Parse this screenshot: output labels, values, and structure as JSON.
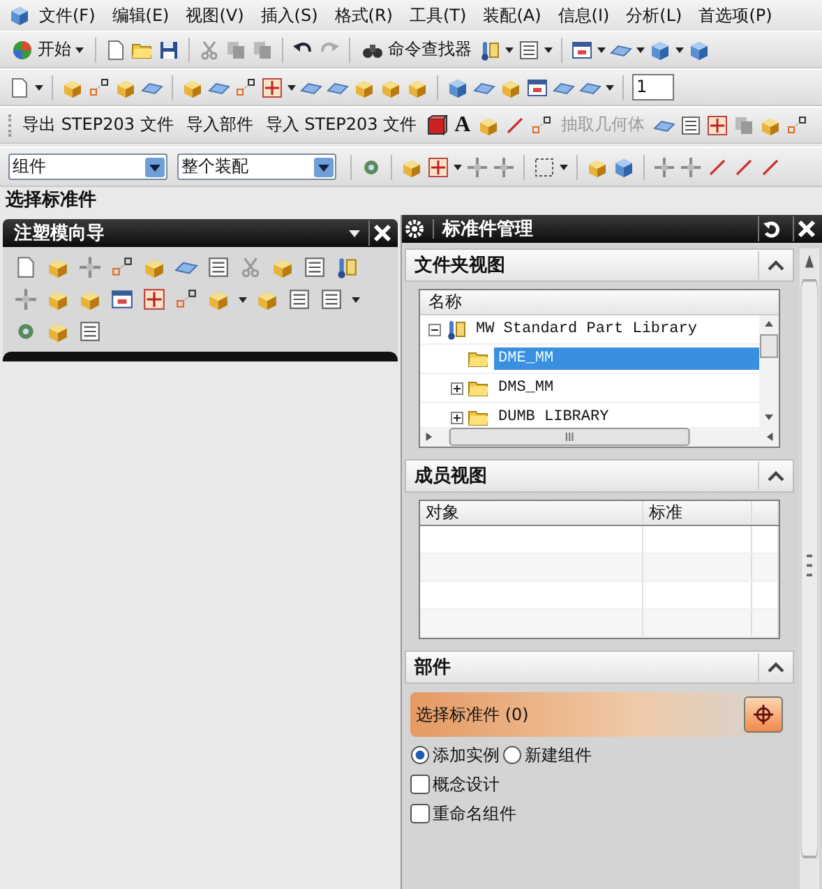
{
  "menu": [
    {
      "label": "文件(F)"
    },
    {
      "label": "编辑(E)"
    },
    {
      "label": "视图(V)"
    },
    {
      "label": "插入(S)"
    },
    {
      "label": "格式(R)"
    },
    {
      "label": "工具(T)"
    },
    {
      "label": "装配(A)"
    },
    {
      "label": "信息(I)"
    },
    {
      "label": "分析(L)"
    },
    {
      "label": "首选项(P)"
    }
  ],
  "toolbar_1": {
    "start_button": "开始",
    "command_finder": "命令查找器"
  },
  "toolbar_2": {
    "layer": "1"
  },
  "toolbar_3": {
    "commands": [
      {
        "label": "导出 STEP203 文件",
        "disabled": false
      },
      {
        "label": "导入部件",
        "disabled": false
      },
      {
        "label": "导入 STEP203 文件",
        "disabled": false
      }
    ],
    "text_tool": "A",
    "extract": {
      "label": "抽取几何体",
      "disabled": true
    }
  },
  "toolbar_4": {
    "filters": [
      {
        "value": "组件"
      },
      {
        "value": "整个装配"
      }
    ]
  },
  "cue_line": "选择标准件",
  "left_panel": {
    "title": "注塑模向导"
  },
  "right_panel": {
    "title": "标准件管理",
    "folder_view": {
      "title": "文件夹视图",
      "expanded": true,
      "column": "名称",
      "tree": [
        {
          "label": "MW Standard Part Library",
          "expanded": true,
          "selected": false,
          "children": [
            {
              "label": "DME_MM",
              "selected": true
            },
            {
              "label": "DMS_MM",
              "expanded": false,
              "selected": false
            },
            {
              "label": "DUMB LIBRARY",
              "expanded": false,
              "selected": false
            }
          ]
        }
      ]
    },
    "member_view": {
      "title": "成员视图",
      "expanded": true,
      "columns": [
        "对象",
        "标准"
      ]
    },
    "parts": {
      "title": "部件",
      "expanded": true,
      "select_label": "选择标准件 (0)",
      "radios": [
        {
          "label": "添加实例",
          "selected": true
        },
        {
          "label": "新建组件",
          "selected": false
        }
      ],
      "checkboxes": [
        {
          "label": "概念设计",
          "checked": false
        },
        {
          "label": "重命名组件",
          "checked": false
        }
      ]
    }
  }
}
